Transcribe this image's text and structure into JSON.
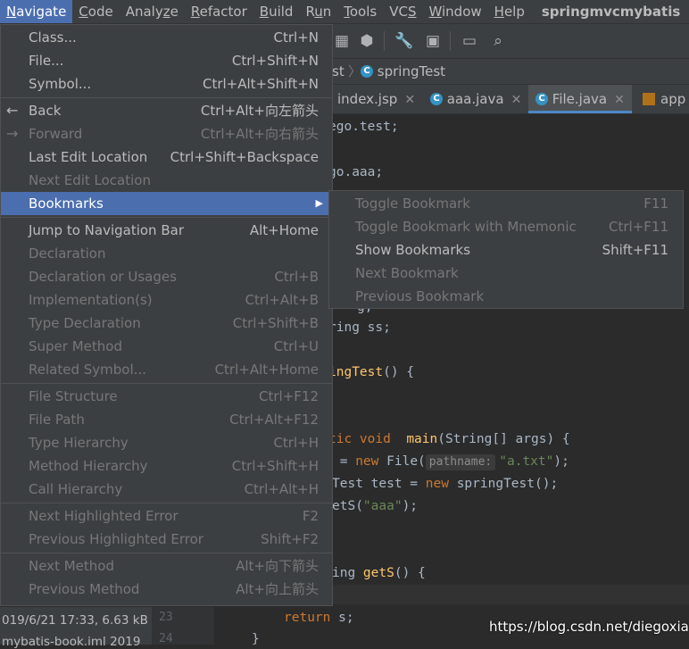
{
  "menubar": {
    "items": [
      {
        "label": "Navigate",
        "mnemonic": "N"
      },
      {
        "label": "Code",
        "mnemonic": "C"
      },
      {
        "label": "Analyze",
        "mnemonic": "z"
      },
      {
        "label": "Refactor",
        "mnemonic": "R"
      },
      {
        "label": "Build",
        "mnemonic": "B"
      },
      {
        "label": "Run",
        "mnemonic": "u"
      },
      {
        "label": "Tools",
        "mnemonic": "T"
      },
      {
        "label": "VCS",
        "mnemonic": "S"
      },
      {
        "label": "Window",
        "mnemonic": "W"
      },
      {
        "label": "Help",
        "mnemonic": "H"
      }
    ],
    "project_title": "springmvcmybatis"
  },
  "navbar": {
    "crumb_partial": "st",
    "crumb_class": "springTest",
    "class_icon_letter": "C"
  },
  "tabs": [
    {
      "label": "index.jsp"
    },
    {
      "label": "aaa.java"
    },
    {
      "label": "File.java"
    },
    {
      "label": "app"
    }
  ],
  "navigate_menu": {
    "groups": [
      [
        {
          "label": "Class...",
          "shortcut": "Ctrl+N",
          "enabled": true
        },
        {
          "label": "File...",
          "shortcut": "Ctrl+Shift+N",
          "enabled": true
        },
        {
          "label": "Symbol...",
          "shortcut": "Ctrl+Alt+Shift+N",
          "enabled": true
        }
      ],
      [
        {
          "label": "Back",
          "shortcut": "Ctrl+Alt+向左箭头",
          "enabled": true,
          "icon": "back-arrow-icon"
        },
        {
          "label": "Forward",
          "shortcut": "Ctrl+Alt+向右箭头",
          "enabled": false,
          "icon": "forward-arrow-icon"
        },
        {
          "label": "Last Edit Location",
          "shortcut": "Ctrl+Shift+Backspace",
          "enabled": true
        },
        {
          "label": "Next Edit Location",
          "shortcut": "",
          "enabled": false
        },
        {
          "label": "Bookmarks",
          "shortcut": "",
          "enabled": true,
          "selected": true,
          "submenu": true
        }
      ],
      [
        {
          "label": "Jump to Navigation Bar",
          "shortcut": "Alt+Home",
          "enabled": true
        },
        {
          "label": "Declaration",
          "shortcut": "",
          "enabled": false
        },
        {
          "label": "Declaration or Usages",
          "shortcut": "Ctrl+B",
          "enabled": false
        },
        {
          "label": "Implementation(s)",
          "shortcut": "Ctrl+Alt+B",
          "enabled": false
        },
        {
          "label": "Type Declaration",
          "shortcut": "Ctrl+Shift+B",
          "enabled": false
        },
        {
          "label": "Super Method",
          "shortcut": "Ctrl+U",
          "enabled": false
        },
        {
          "label": "Related Symbol...",
          "shortcut": "Ctrl+Alt+Home",
          "enabled": false
        }
      ],
      [
        {
          "label": "File Structure",
          "shortcut": "Ctrl+F12",
          "enabled": false
        },
        {
          "label": "File Path",
          "shortcut": "Ctrl+Alt+F12",
          "enabled": false
        },
        {
          "label": "Type Hierarchy",
          "shortcut": "Ctrl+H",
          "enabled": false
        },
        {
          "label": "Method Hierarchy",
          "shortcut": "Ctrl+Shift+H",
          "enabled": false
        },
        {
          "label": "Call Hierarchy",
          "shortcut": "Ctrl+Alt+H",
          "enabled": false
        }
      ],
      [
        {
          "label": "Next Highlighted Error",
          "shortcut": "F2",
          "enabled": false
        },
        {
          "label": "Previous Highlighted Error",
          "shortcut": "Shift+F2",
          "enabled": false
        }
      ],
      [
        {
          "label": "Next Method",
          "shortcut": "Alt+向下箭头",
          "enabled": false
        },
        {
          "label": "Previous Method",
          "shortcut": "Alt+向上箭头",
          "enabled": false
        }
      ]
    ]
  },
  "bookmarks_submenu": {
    "items": [
      {
        "label": "Toggle Bookmark",
        "shortcut": "F11",
        "enabled": false
      },
      {
        "label": "Toggle Bookmark with Mnemonic",
        "shortcut": "Ctrl+F11",
        "enabled": false
      },
      {
        "label": "Show Bookmarks",
        "shortcut": "Shift+F11",
        "enabled": true
      },
      {
        "label": "Next Bookmark",
        "shortcut": "",
        "enabled": false
      },
      {
        "label": "Previous Bookmark",
        "shortcut": "",
        "enabled": false
      }
    ]
  },
  "code_fragments": {
    "l1": "ego.test;",
    "l2": "go.aaa;",
    "l3": "g;",
    "l4_type": "ring",
    "l4_rest": " ss;",
    "l5_name": "ingTest",
    "l5_rest": "() {",
    "l6_kw": "tic void",
    "l6_fn": "main",
    "l6_rest": "(String[] args) {",
    "l7_pre": " = ",
    "l7_new": "new",
    "l7_call": " File(",
    "l7_hint": "pathname:",
    "l7_str": "\"a.txt\"",
    "l7_end": ");",
    "l8_pre": "Test test = ",
    "l8_new": "new",
    "l8_rest": " springTest();",
    "l9_pre": "etS(",
    "l9_str": "\"aaa\"",
    "l9_end": ");",
    "l10_pre": "ing ",
    "l10_fn": "getS",
    "l10_rest": "() {",
    "l11_kw": "return",
    "l11_rest": " s;",
    "l12": "}"
  },
  "project_panel": {
    "line1": "019/6/21 17:33, 6.63 kB",
    "line2": "mybatis-book.iml  2019"
  },
  "gutter": {
    "line_a": "23",
    "line_b": "24"
  },
  "watermark": "https://blog.csdn.net/diegoxiao"
}
